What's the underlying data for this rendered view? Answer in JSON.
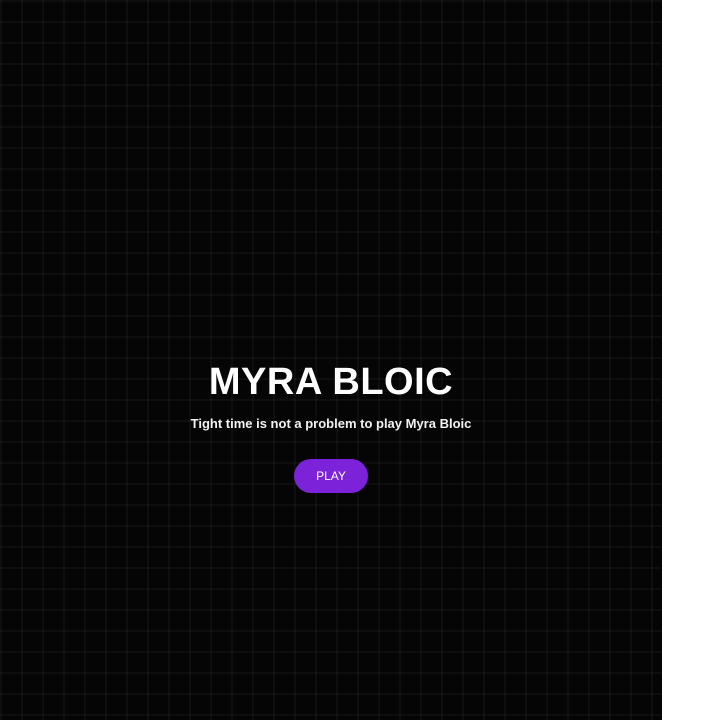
{
  "hero": {
    "title": "MYRA BLOIC",
    "subtitle": "Tight time is not a problem to play Myra Bloic",
    "play_label": "PLAY"
  },
  "colors": {
    "background": "#050505",
    "accent": "#7c22d9",
    "side_panel": "#ffffff"
  }
}
